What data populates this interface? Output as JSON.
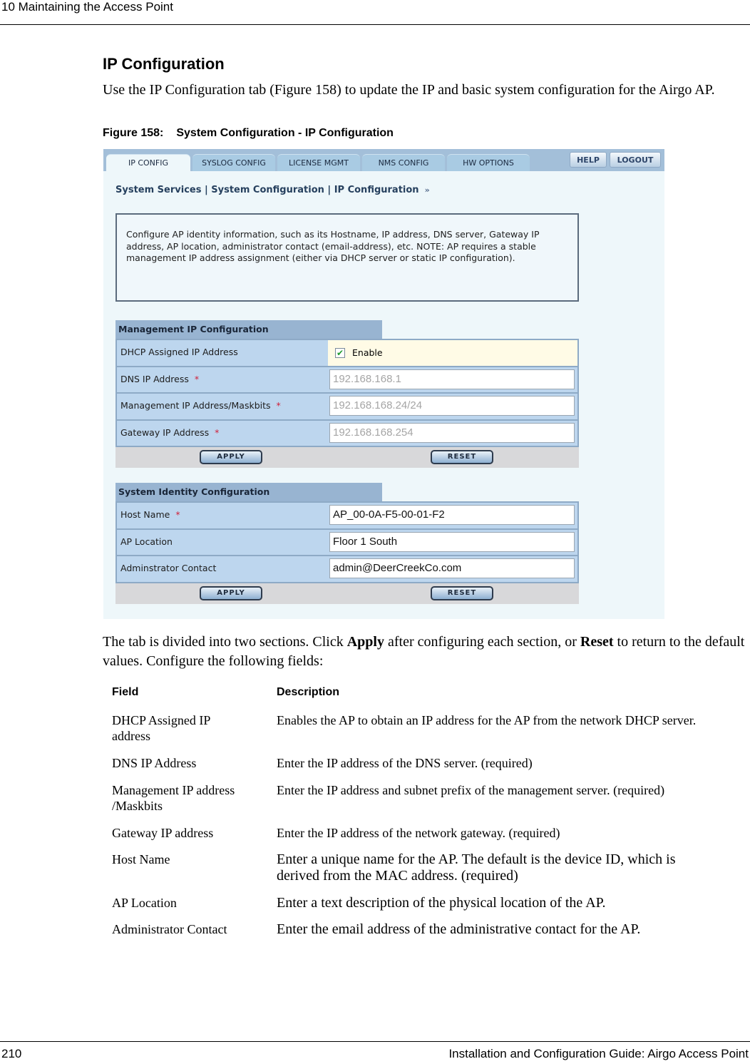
{
  "page": {
    "header": "10  Maintaining the Access Point",
    "footer_left": "210",
    "footer_right": "Installation and Configuration Guide: Airgo Access Point",
    "section_title": "IP Configuration",
    "intro": "Use the IP Configuration tab (Figure 158) to update the IP and basic system configuration for the Airgo AP.",
    "figure_number": "Figure 158:",
    "figure_title": "System Configuration - IP Configuration",
    "body_parts": [
      "The tab is divided into two sections. Click ",
      "Apply",
      " after configuring each section, or ",
      "Reset",
      " to return to the default values. Configure the following fields:"
    ]
  },
  "ui": {
    "tabs": [
      {
        "label": "IP CONFIG",
        "active": true
      },
      {
        "label": "SYSLOG CONFIG",
        "active": false
      },
      {
        "label": "LICENSE MGMT",
        "active": false
      },
      {
        "label": "NMS CONFIG",
        "active": false
      },
      {
        "label": "HW OPTIONS",
        "active": false
      }
    ],
    "help_label": "HELP",
    "logout_label": "LOGOUT",
    "breadcrumb": "System Services | System Configuration | IP Configuration",
    "breadcrumb_arrow": "»",
    "info_text": "Configure AP identity information, such as its Hostname, IP address, DNS server, Gateway IP address, AP location, administrator contact (email-address), etc. NOTE: AP requires a stable management IP address assignment (either via DHCP server or static IP configuration).",
    "required_marker": "*",
    "management": {
      "title": "Management IP Configuration",
      "dhcp_label": "DHCP Assigned IP Address",
      "dhcp_checked": true,
      "dhcp_option": "Enable",
      "dns_label": "DNS IP Address",
      "dns_value": "192.168.168.1",
      "mgmt_label": "Management IP Address/Maskbits",
      "mgmt_value": "192.168.168.24/24",
      "gateway_label": "Gateway IP Address",
      "gateway_value": "192.168.168.254",
      "apply_label": "APPLY",
      "reset_label": "RESET"
    },
    "identity": {
      "title": "System Identity Configuration",
      "host_label": "Host Name",
      "host_value": "AP_00-0A-F5-00-01-F2",
      "location_label": "AP Location",
      "location_value": "Floor 1 South",
      "contact_label": "Adminstrator Contact",
      "contact_value": "admin@DeerCreekCo.com",
      "apply_label": "APPLY",
      "reset_label": "RESET"
    }
  },
  "table": {
    "headers": [
      "Field",
      "Description"
    ],
    "rows": [
      {
        "field": "DHCP Assigned IP address",
        "description": "Enables the AP to obtain an IP address for the AP from the network DHCP server."
      },
      {
        "field": "DNS IP Address",
        "description": "Enter the IP address of the DNS server. (required)"
      },
      {
        "field": "Management IP address /Maskbits",
        "description": "Enter the IP address and subnet prefix of the management server. (required)"
      },
      {
        "field": "Gateway IP address",
        "description": "Enter the IP address of the network gateway. (required)"
      },
      {
        "field": "Host Name",
        "description": "Enter a unique name for the AP. The default is the device ID, which is derived from the MAC address. (required)"
      },
      {
        "field": "AP Location",
        "description": "Enter a text description of the physical location of the AP."
      },
      {
        "field": "Administrator Contact",
        "description": "Enter the email address of the administrative contact for the AP."
      }
    ]
  }
}
